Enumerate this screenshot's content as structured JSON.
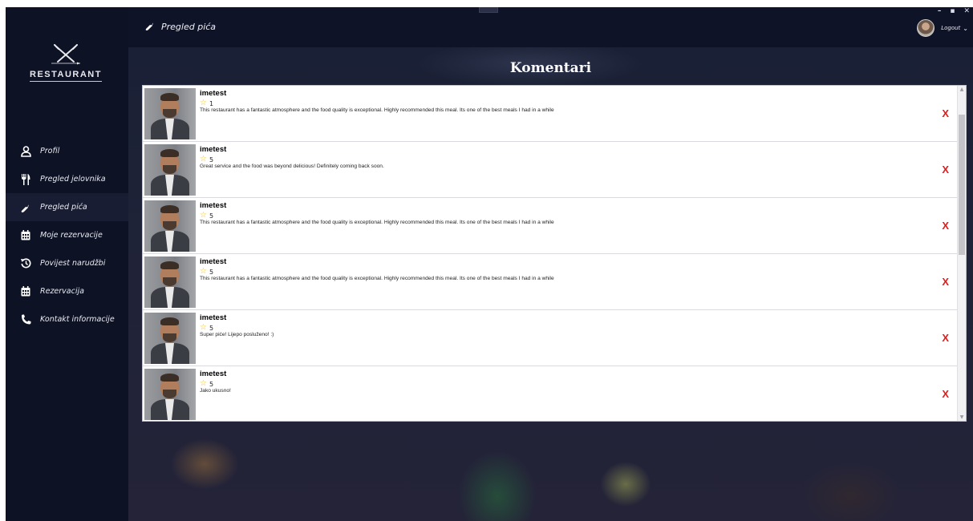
{
  "topbar": {
    "page_title": "Pregled pića",
    "logout_label": "Logout",
    "window_controls": [
      "–",
      "▪",
      "✕"
    ]
  },
  "sidebar": {
    "logo_text": "RESTAURANT",
    "items": [
      {
        "label": "Profil",
        "icon": "user-icon"
      },
      {
        "label": "Pregled jelovnika",
        "icon": "cutlery-icon"
      },
      {
        "label": "Pregled pića",
        "icon": "bottle-icon",
        "active": true
      },
      {
        "label": "Moje rezervacije",
        "icon": "calendar-icon"
      },
      {
        "label": "Povijest narudžbi",
        "icon": "history-icon"
      },
      {
        "label": "Rezervacija",
        "icon": "calendar-icon"
      },
      {
        "label": "Kontakt informacije",
        "icon": "phone-icon"
      }
    ]
  },
  "main": {
    "title": "Komentari",
    "comments": [
      {
        "user": "imetest",
        "rating": "1",
        "text": "This restaurant has a fantastic atmosphere and the food quality is exceptional. Highly recommended this meal. Its one of the best meals I had in a while",
        "delete_label": "X"
      },
      {
        "user": "imetest",
        "rating": "5",
        "text": "Great service and the food was beyond delicious! Definitely coming back soon.",
        "delete_label": "X"
      },
      {
        "user": "imetest",
        "rating": "5",
        "text": "This restaurant has a fantastic atmosphere and the food quality is exceptional. Highly recommended this meal. Its one of the best meals I had in a while",
        "delete_label": "X"
      },
      {
        "user": "imetest",
        "rating": "5",
        "text": "This restaurant has a fantastic atmosphere and the food quality is exceptional. Highly recommended this meal. Its one of the best meals I had in a while",
        "delete_label": "X"
      },
      {
        "user": "imetest",
        "rating": "5",
        "text": "Super piće! Lijepo posluženo! :)",
        "delete_label": "X"
      },
      {
        "user": "imetest",
        "rating": "5",
        "text": "Jako ukusno!",
        "delete_label": "X"
      }
    ]
  },
  "colors": {
    "sidebar_bg": "#0d1224",
    "delete_red": "#e21b1b",
    "star_yellow": "#f2c21b"
  }
}
